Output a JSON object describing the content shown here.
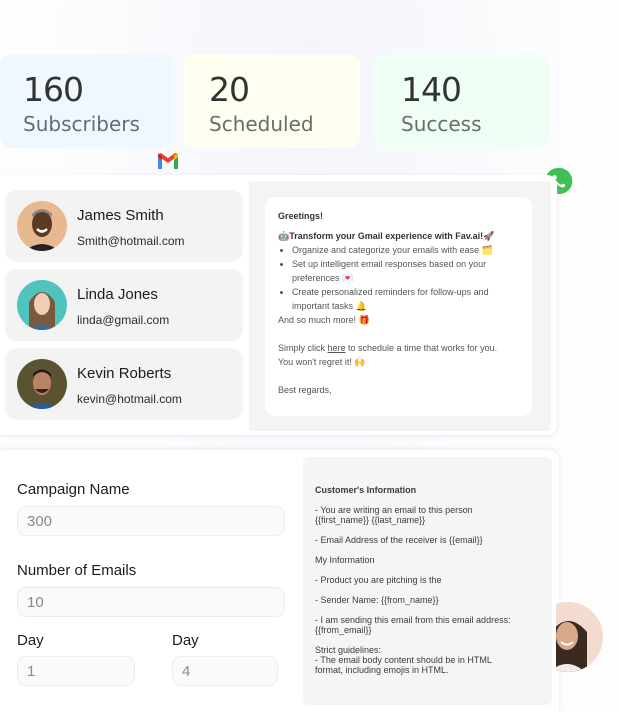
{
  "stats": [
    {
      "value": "160",
      "label": "Subscribers",
      "bg": "#f0f8ff"
    },
    {
      "value": "20",
      "label": "Scheduled",
      "bg": "#fefff0"
    },
    {
      "value": "140",
      "label": "Success",
      "bg": "#effff5"
    }
  ],
  "icons": {
    "gmail": "gmail-logo",
    "whatsapp": "whatsapp-logo"
  },
  "contacts": [
    {
      "name": "James Smith",
      "email": "Smith@hotmail.com",
      "avatar_bg": "#e8b891"
    },
    {
      "name": "Linda  Jones",
      "email": "linda@gmail.com",
      "avatar_bg": "#4fc4bc"
    },
    {
      "name": "Kevin Roberts",
      "email": "kevin@hotmail.com",
      "avatar_bg": "#5b5232"
    }
  ],
  "email_preview": {
    "greeting": "Greetings!",
    "headline": "🤖Transform your Gmail experience with Fav.ai!🚀",
    "bullets": [
      "Organize and categorize your emails with ease 🗂️",
      "Set up intelligent email responses based on your preferences 💌",
      "Create personalized reminders for follow-ups and important tasks 🔔"
    ],
    "more": "And so much more! 🎁",
    "cta_prefix": "Simply click ",
    "cta_link": "here",
    "cta_suffix": " to schedule a time that works for you.",
    "cta_line2": "You won't regret it! 🙌",
    "signoff": "Best regards,"
  },
  "form": {
    "campaign_name_label": "Campaign Name",
    "campaign_name_value": "300",
    "num_emails_label": "Number of Emails",
    "num_emails_value": "10",
    "day1_label": "Day",
    "day1_value": "1",
    "day2_label": "Day",
    "day2_value": "4"
  },
  "prompt": {
    "customer_heading": "Customer's Information",
    "line1": " - You are writing an email to this person\n{{first_name}} {{last_name}}",
    "line2": "- Email Address of the receiver is {{email}}",
    "my_info": "My Information",
    "line3": "- Product you are pitching is the",
    "line4": "- Sender Name: {{from_name}}",
    "line5": "- I am sending this email from this email address:\n{{from_email}}",
    "guidelines": "Strict guidelines:\n- The email body content should be in HTML\nformat, including emojis in HTML."
  }
}
